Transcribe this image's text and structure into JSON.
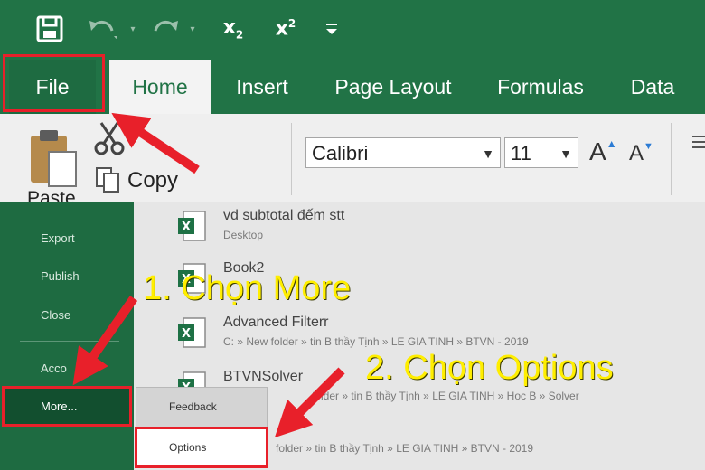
{
  "qat": {
    "save_icon": "save-icon",
    "undo_icon": "undo-icon",
    "redo_icon": "redo-icon",
    "subscript_label": "x",
    "subscript_sub": "2",
    "superscript_label": "x",
    "superscript_sup": "2",
    "customize_icon": "customize-qat-icon"
  },
  "tabs": [
    "File",
    "Home",
    "Insert",
    "Page Layout",
    "Formulas",
    "Data"
  ],
  "ribbon": {
    "paste_label": "Paste",
    "copy_label": "Copy",
    "font_name": "Calibri",
    "font_size": "11",
    "grow_font": "A",
    "shrink_font": "A"
  },
  "backstage": {
    "nav": [
      "Export",
      "Publish",
      "Close",
      "Acco",
      "More..."
    ],
    "recent": [
      {
        "name": "vd subtotal đếm stt",
        "path": "Desktop"
      },
      {
        "name": "Book2",
        "path": ""
      },
      {
        "name": "Advanced Filterr",
        "path": "C: » New folder » tin B thầy Tịnh » LE GIA TINH » BTVN - 2019"
      },
      {
        "name": "BTVNSolver",
        "path": "folder » tin B thầy Tịnh » LE GIA TINH » Hoc B » Solver"
      },
      {
        "name": "",
        "path": "folder » tin B thầy Tịnh » LE GIA TINH » BTVN - 2019"
      }
    ],
    "flyout": {
      "feedback": "Feedback",
      "options": "Options"
    }
  },
  "annotations": {
    "step1": "1. Chọn More",
    "step2": "2. Chọn Options",
    "color": "#ffee00",
    "highlight_color": "#e8202a"
  },
  "colors": {
    "excel_green": "#217346",
    "backstage_green": "#1e6b41",
    "ribbon_bg": "#efefef"
  }
}
